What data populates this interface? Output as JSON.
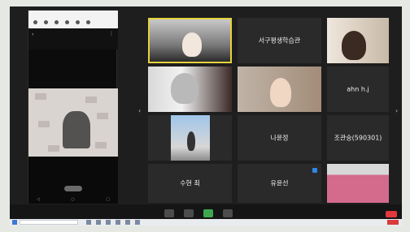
{
  "phone": {
    "bar_label": "",
    "header_title": ""
  },
  "participants": [
    {
      "label": "",
      "name_visible": false
    },
    {
      "label": "서구평생학습관",
      "name_visible": true
    },
    {
      "label": "",
      "name_visible": false
    },
    {
      "label": "",
      "name_visible": false
    },
    {
      "label": "",
      "name_visible": false
    },
    {
      "label": "ahn h.j",
      "name_visible": true
    },
    {
      "label": "",
      "name_visible": false
    },
    {
      "label": "나윤정",
      "name_visible": true
    },
    {
      "label": "조관숭(590301)",
      "name_visible": true
    },
    {
      "label": "수현 최",
      "name_visible": true
    },
    {
      "label": "유윤선",
      "name_visible": true
    },
    {
      "label": "",
      "name_visible": false
    }
  ],
  "colors": {
    "active_speaker_border": "#e6d23b",
    "end_button": "#e2373c",
    "video_on": "#3ea84f",
    "badge": "#2f86e8"
  },
  "icons": [
    "back-icon",
    "more-icon",
    "prev-page-icon",
    "next-page-icon",
    "mic-icon",
    "video-icon",
    "share-icon",
    "chat-icon",
    "end-icon"
  ]
}
